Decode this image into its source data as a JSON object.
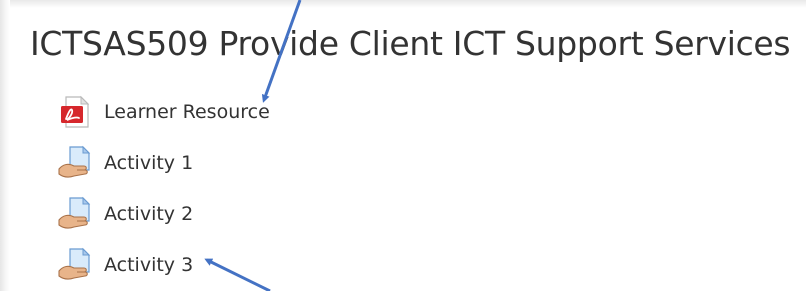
{
  "section": {
    "title": "ICTSAS509 Provide Client ICT Support Services"
  },
  "activities": [
    {
      "label": "Learner Resource",
      "icon": "pdf-file-icon"
    },
    {
      "label": "Activity 1",
      "icon": "assignment-icon"
    },
    {
      "label": "Activity 2",
      "icon": "assignment-icon"
    },
    {
      "label": "Activity 3",
      "icon": "assignment-icon"
    }
  ],
  "colors": {
    "text": "#333333",
    "annotation_arrow": "#4472c4",
    "pdf_red": "#d6272c",
    "assignment_hand": "#e8b48a",
    "assignment_doc": "#cfe3f7"
  }
}
